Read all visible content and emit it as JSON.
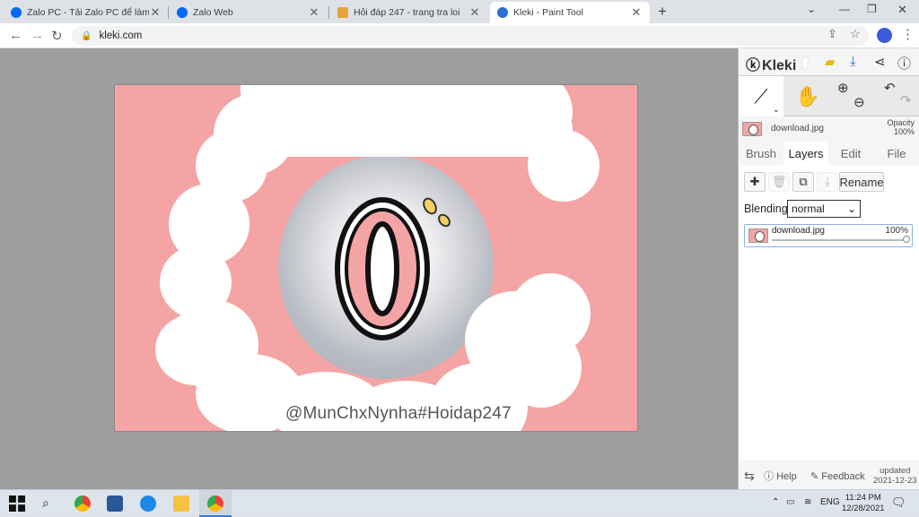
{
  "tabs": [
    {
      "title": "Zalo PC - Tải Zalo PC để làm việc",
      "favicon": "zalo-icon",
      "color": "#0068ff"
    },
    {
      "title": "Zalo Web",
      "favicon": "zalo-icon",
      "color": "#0068ff"
    },
    {
      "title": "Hỏi đáp 247 - trang tra loi",
      "favicon": "hoidap-icon",
      "color": "#e8a33c"
    },
    {
      "title": "Kleki - Paint Tool",
      "favicon": "kleki-icon",
      "color": "#2b6fd6"
    }
  ],
  "address_bar": {
    "url": "kleki.com"
  },
  "artwork": {
    "watermark": "@MunChxNynha#Hoidap247",
    "background_color": "#f4a4a5"
  },
  "panel": {
    "logo": "Kleki",
    "layer_header": {
      "file": "download.jpg",
      "opacity_label": "Opacity",
      "opacity_value": "100%"
    },
    "tabs": [
      "Brush",
      "Layers",
      "Edit",
      "File"
    ],
    "active_tab": "Layers",
    "rename_label": "Rename",
    "blending_label": "Blending",
    "blending_value": "normal",
    "layers": [
      {
        "name": "download.jpg",
        "opacity": "100%"
      }
    ],
    "footer": {
      "help": "Help",
      "feedback": "Feedback",
      "updated_label": "updated",
      "updated_date": "2021-12-23"
    }
  },
  "taskbar": {
    "lang": "ENG",
    "time": "11:24 PM",
    "date": "12/28/2021"
  }
}
